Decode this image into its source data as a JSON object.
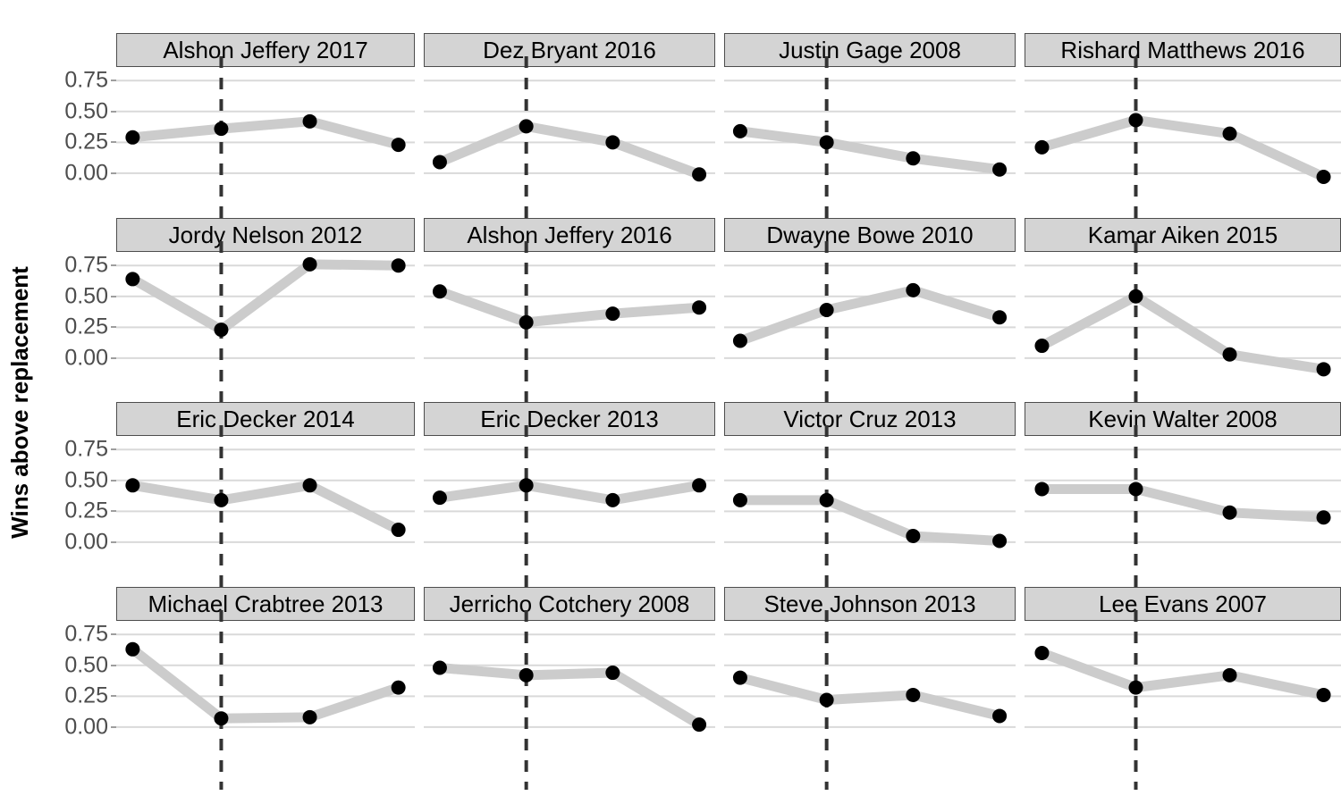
{
  "axis": {
    "y_title": "Wins above replacement",
    "y_ticks": [
      "0.75",
      "0.50",
      "0.25",
      "0.00"
    ],
    "y_tick_values": [
      0.75,
      0.5,
      0.25,
      0.0
    ]
  },
  "style": {
    "line_color": "#cccccc",
    "point_color": "#000000",
    "grid_color": "#d9d9d9",
    "strip_fill": "#d4d4d4",
    "strip_border": "#4d4d4d",
    "vline_color": "#333333",
    "text_color": "#4d4d4d"
  },
  "chart_data": {
    "type": "line",
    "title": "",
    "xlabel": "",
    "ylabel": "Wins above replacement",
    "ylim": [
      -0.16,
      0.86
    ],
    "y_ticks": [
      0.0,
      0.25,
      0.5,
      0.75
    ],
    "grid": "horizontal",
    "legend": "none",
    "x": [
      1,
      2,
      3,
      4
    ],
    "annotation": "dashed vertical reference line at x = 2 in every panel",
    "facet_layout": {
      "rows": 4,
      "cols": 4
    },
    "panels": [
      {
        "title": "Alshon Jeffery 2017",
        "values": [
          0.29,
          0.36,
          0.42,
          0.23
        ]
      },
      {
        "title": "Dez Bryant 2016",
        "values": [
          0.09,
          0.38,
          0.25,
          -0.01
        ]
      },
      {
        "title": "Justin Gage 2008",
        "values": [
          0.34,
          0.25,
          0.12,
          0.03
        ]
      },
      {
        "title": "Rishard Matthews 2016",
        "values": [
          0.21,
          0.43,
          0.32,
          -0.03
        ]
      },
      {
        "title": "Jordy Nelson 2012",
        "values": [
          0.64,
          0.23,
          0.76,
          0.75
        ]
      },
      {
        "title": "Alshon Jeffery 2016",
        "values": [
          0.54,
          0.29,
          0.36,
          0.41
        ]
      },
      {
        "title": "Dwayne Bowe 2010",
        "values": [
          0.14,
          0.39,
          0.55,
          0.33
        ]
      },
      {
        "title": "Kamar Aiken 2015",
        "values": [
          0.1,
          0.5,
          0.03,
          -0.09
        ]
      },
      {
        "title": "Eric Decker 2014",
        "values": [
          0.46,
          0.34,
          0.46,
          0.1
        ]
      },
      {
        "title": "Eric Decker 2013",
        "values": [
          0.36,
          0.46,
          0.34,
          0.46
        ]
      },
      {
        "title": "Victor Cruz 2013",
        "values": [
          0.34,
          0.34,
          0.05,
          0.01
        ]
      },
      {
        "title": "Kevin Walter 2008",
        "values": [
          0.43,
          0.43,
          0.24,
          0.2
        ]
      },
      {
        "title": "Michael Crabtree 2013",
        "values": [
          0.63,
          0.07,
          0.08,
          0.32
        ]
      },
      {
        "title": "Jerricho Cotchery 2008",
        "values": [
          0.48,
          0.42,
          0.44,
          0.02
        ]
      },
      {
        "title": "Steve Johnson 2013",
        "values": [
          0.4,
          0.22,
          0.26,
          0.09
        ]
      },
      {
        "title": "Lee Evans 2007",
        "values": [
          0.6,
          0.32,
          0.42,
          0.26
        ]
      }
    ]
  }
}
